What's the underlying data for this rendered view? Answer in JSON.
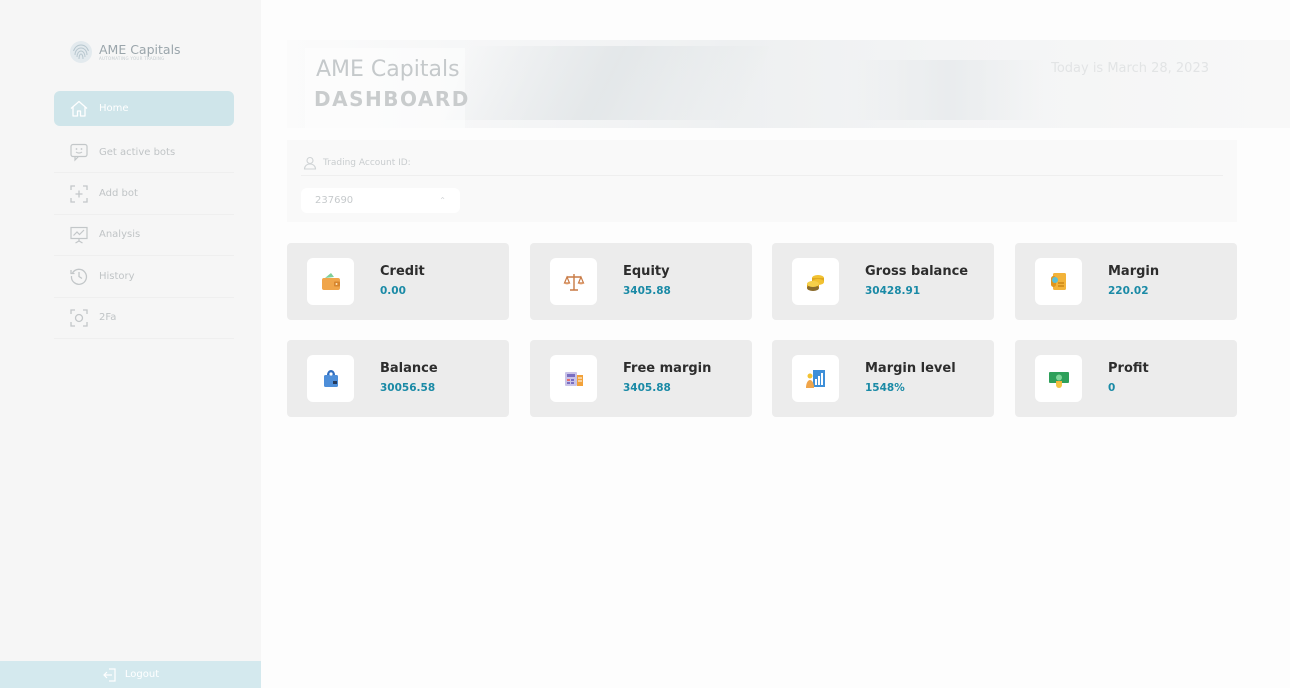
{
  "brand": {
    "name": "AME Capitals",
    "tagline": "AUTOMATING YOUR TRADING"
  },
  "nav": {
    "items": [
      {
        "label": "Home",
        "icon": "home-icon",
        "active": true
      },
      {
        "label": "Get active bots",
        "icon": "bot-face-icon",
        "active": false
      },
      {
        "label": "Add bot",
        "icon": "add-square-icon",
        "active": false
      },
      {
        "label": "Analysis",
        "icon": "chart-board-icon",
        "active": false
      },
      {
        "label": "History",
        "icon": "history-icon",
        "active": false
      },
      {
        "label": "2Fa",
        "icon": "scan-icon",
        "active": false
      }
    ],
    "logout_label": "Logout"
  },
  "header": {
    "title": "AME Capitals",
    "subtitle": "DASHBOARD",
    "date_text": "Today is March 28, 2023"
  },
  "account": {
    "tab_label": "Trading Account ID:",
    "selected_id": "237690"
  },
  "cards": [
    {
      "title": "Credit",
      "value": "0.00",
      "icon": "wallet-icon"
    },
    {
      "title": "Equity",
      "value": "3405.88",
      "icon": "scales-icon"
    },
    {
      "title": "Gross balance",
      "value": "30428.91",
      "icon": "coins-icon"
    },
    {
      "title": "Margin",
      "value": "220.02",
      "icon": "scroll-money-icon"
    },
    {
      "title": "Balance",
      "value": "30056.58",
      "icon": "safe-bag-icon"
    },
    {
      "title": "Free margin",
      "value": "3405.88",
      "icon": "calculator-icon"
    },
    {
      "title": "Margin level",
      "value": "1548%",
      "icon": "chart-person-icon"
    },
    {
      "title": "Profit",
      "value": "0",
      "icon": "cash-icon"
    }
  ],
  "colors": {
    "accent": "#1a8aa6",
    "active_nav": "#cfe5ea",
    "card_bg": "#ececec"
  }
}
